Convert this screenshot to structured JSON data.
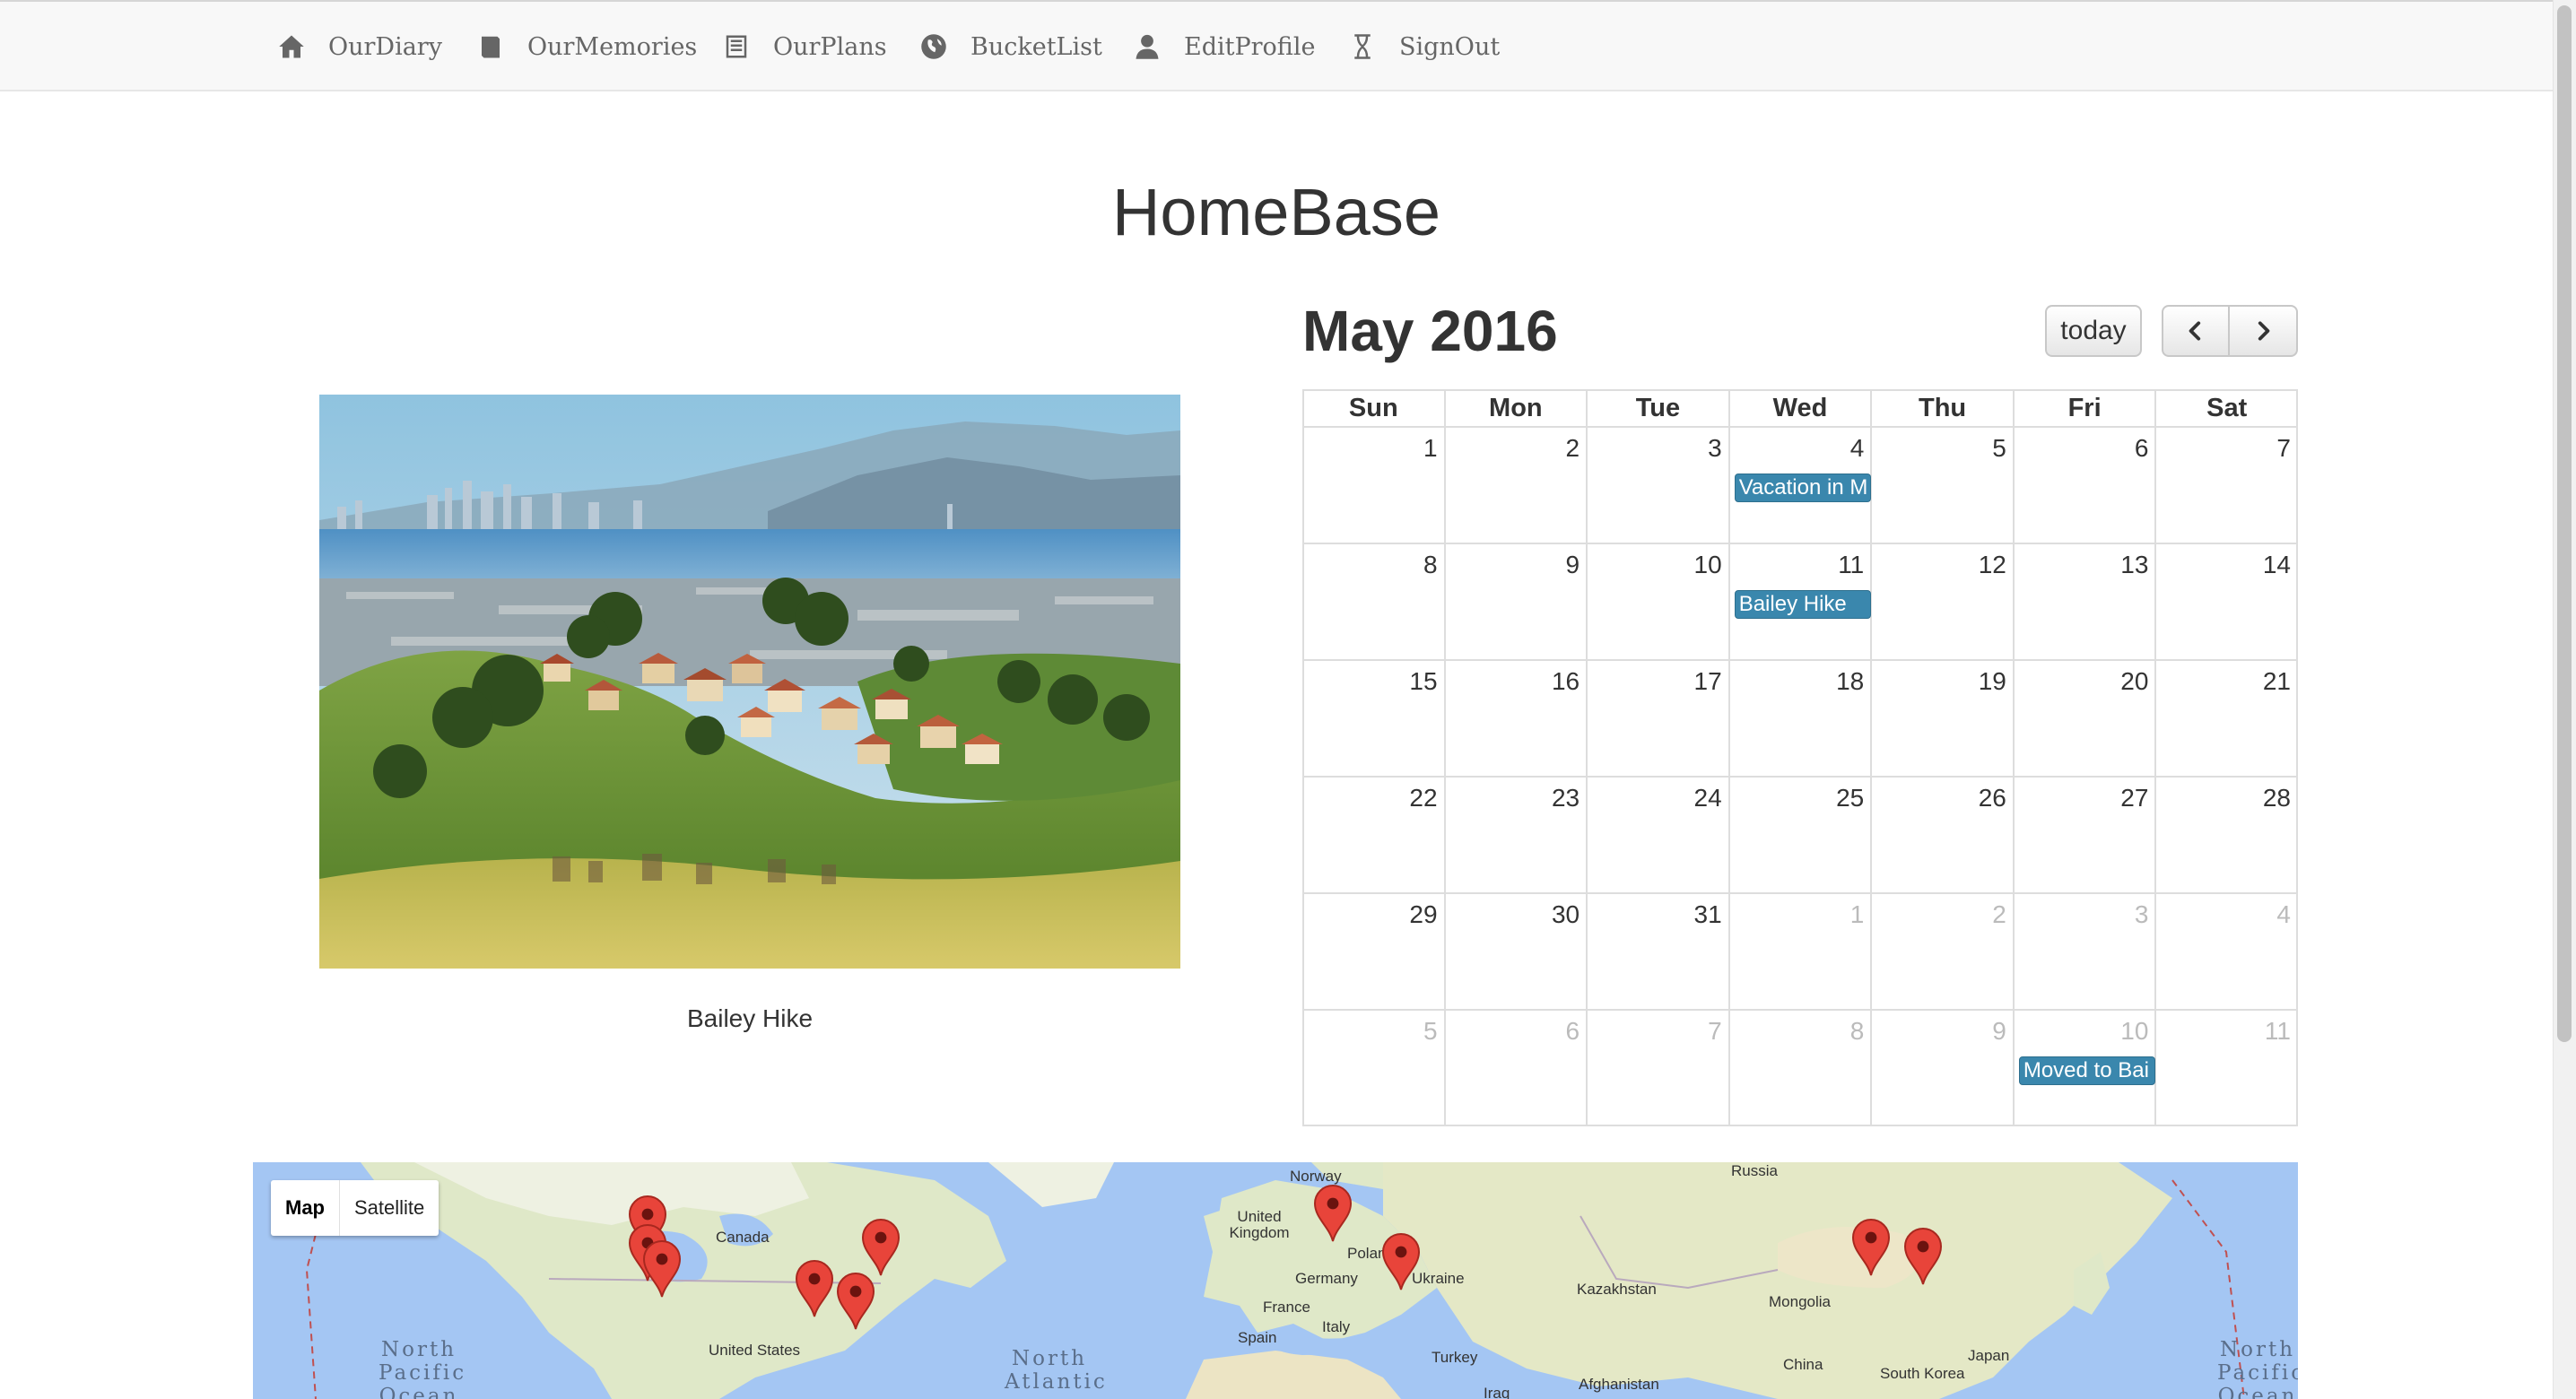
{
  "nav": {
    "items": [
      {
        "label": "OurDiary",
        "icon": "home-icon"
      },
      {
        "label": "OurMemories",
        "icon": "book-icon"
      },
      {
        "label": "OurPlans",
        "icon": "list-icon"
      },
      {
        "label": "BucketList",
        "icon": "globe-icon"
      },
      {
        "label": "EditProfile",
        "icon": "user-icon"
      },
      {
        "label": "SignOut",
        "icon": "hourglass-icon"
      }
    ]
  },
  "page": {
    "title": "HomeBase"
  },
  "photo": {
    "caption": "Bailey Hike"
  },
  "calendar": {
    "title": "May 2016",
    "today_label": "today",
    "weekdays": [
      "Sun",
      "Mon",
      "Tue",
      "Wed",
      "Thu",
      "Fri",
      "Sat"
    ],
    "weeks": [
      [
        "1",
        "2",
        "3",
        "4",
        "5",
        "6",
        "7"
      ],
      [
        "8",
        "9",
        "10",
        "11",
        "12",
        "13",
        "14"
      ],
      [
        "15",
        "16",
        "17",
        "18",
        "19",
        "20",
        "21"
      ],
      [
        "22",
        "23",
        "24",
        "25",
        "26",
        "27",
        "28"
      ],
      [
        "29",
        "30",
        "31",
        "1",
        "2",
        "3",
        "4"
      ],
      [
        "5",
        "6",
        "7",
        "8",
        "9",
        "10",
        "11"
      ]
    ],
    "events": [
      {
        "title": "Vacation in M",
        "week": 0,
        "day": 3
      },
      {
        "title": "Bailey Hike",
        "week": 1,
        "day": 3
      },
      {
        "title": "Moved to Bai",
        "week": 5,
        "day": 5
      }
    ],
    "event_color": "#3a87ad"
  },
  "map": {
    "type_buttons": [
      "Map",
      "Satellite"
    ],
    "selected_type": "Map",
    "labels": [
      "Russia",
      "Norway",
      "United Kingdom",
      "Poland",
      "Germany",
      "Ukraine",
      "France",
      "Kazakhstan",
      "Mongolia",
      "Italy",
      "Spain",
      "Turkey",
      "China",
      "South Korea",
      "Japan",
      "Afghanistan",
      "Iraq",
      "Canada",
      "United States"
    ],
    "oceans": [
      "North Pacific Ocean",
      "North Atlantic",
      "North Pacific Ocean"
    ],
    "marker_color": "#e8443a"
  }
}
